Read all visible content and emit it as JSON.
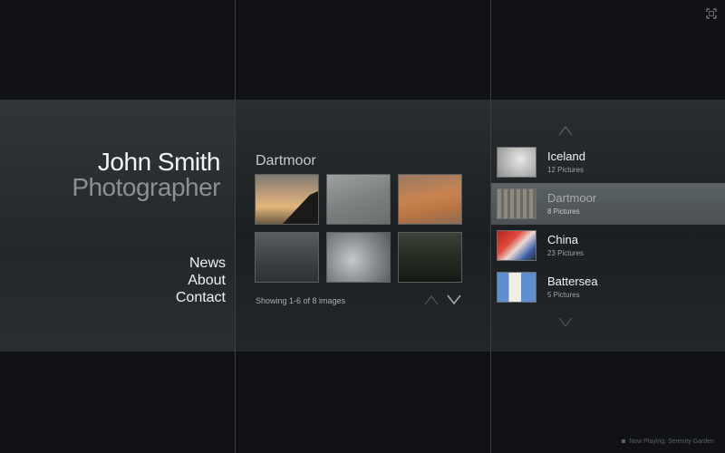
{
  "header": {
    "name": "John Smith",
    "role": "Photographer",
    "fullscreen_icon": "fullscreen-icon"
  },
  "nav": {
    "items": [
      "News",
      "About",
      "Contact"
    ]
  },
  "gallery": {
    "title": "Dartmoor",
    "showing": "Showing 1-6 of 8 images",
    "thumbs": [
      {
        "alt": "sunset-cliff"
      },
      {
        "alt": "grey-clouds"
      },
      {
        "alt": "orange-sky"
      },
      {
        "alt": "dark-storm"
      },
      {
        "alt": "white-clouds"
      },
      {
        "alt": "forest-hills"
      }
    ],
    "nav_icons": [
      "chevron-up-icon",
      "chevron-down-icon"
    ]
  },
  "albums": {
    "items": [
      {
        "name": "Iceland",
        "count": "12 Pictures"
      },
      {
        "name": "Dartmoor",
        "count": "8 Pictures",
        "selected": true
      },
      {
        "name": "China",
        "count": "23 Pictures"
      },
      {
        "name": "Battersea",
        "count": "5 Pictures"
      }
    ],
    "nav_icons": [
      "chevron-up-icon",
      "chevron-down-icon"
    ]
  },
  "footer": {
    "now_playing": "Now Playing: Serenity Garden"
  },
  "colors": {
    "background": "#111216",
    "band": "#23272a",
    "selected": "#52595c"
  }
}
